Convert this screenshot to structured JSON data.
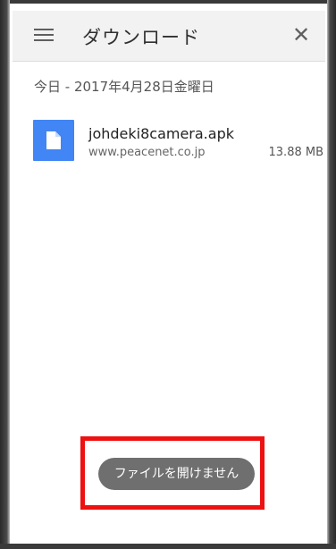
{
  "toolbar": {
    "title": "ダウンロード",
    "menu_icon": "hamburger-menu-icon",
    "close_icon": "close-icon",
    "close_glyph": "✕"
  },
  "date_header": "今日 - 2017年4月28日金曜日",
  "downloads": [
    {
      "file_name": "johdeki8camera.apk",
      "domain": "www.peacenet.co.jp",
      "size": "13.88 MB",
      "icon": "file-icon"
    }
  ],
  "toast": {
    "message": "ファイルを開けません"
  },
  "colors": {
    "file_icon_bg": "#4285f4",
    "highlight": "#ee1111",
    "toast_bg": "#6f6f6f"
  }
}
